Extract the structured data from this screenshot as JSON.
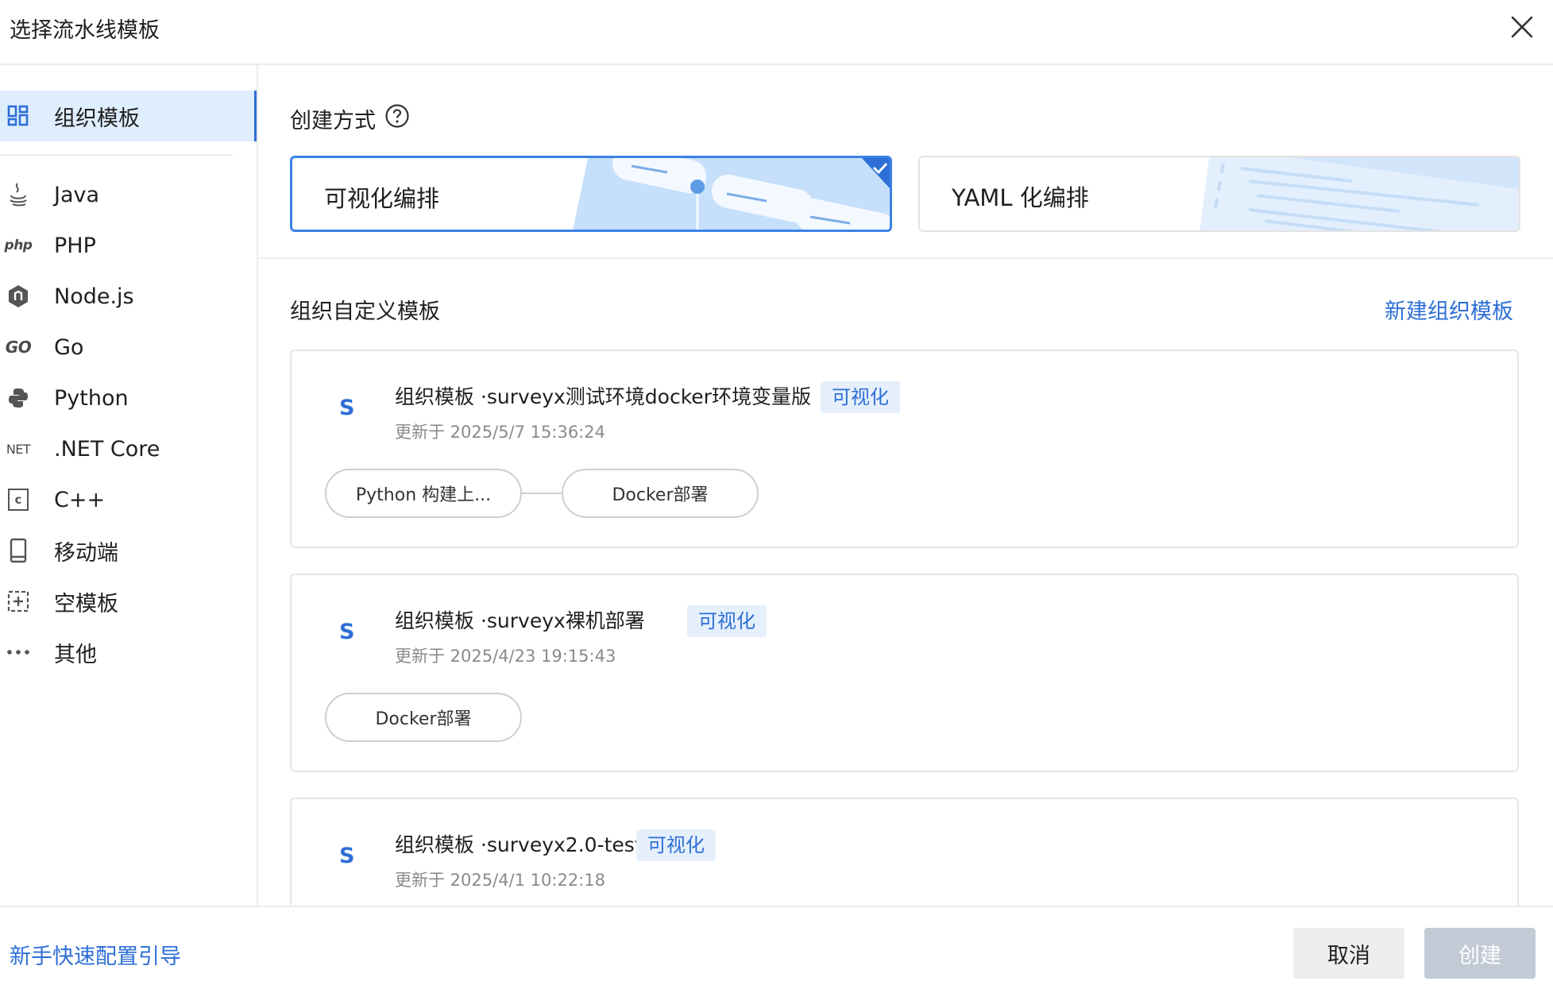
{
  "dialog": {
    "title": "选择流水线模板",
    "close_icon": "close-icon"
  },
  "sidebar": {
    "items": [
      {
        "label": "组织模板",
        "icon": "grid-icon",
        "active": true
      },
      {
        "label": "Java",
        "icon": "java-icon"
      },
      {
        "label": "PHP",
        "icon": "php-icon",
        "icon_text": "php"
      },
      {
        "label": "Node.js",
        "icon": "nodejs-icon"
      },
      {
        "label": "Go",
        "icon": "go-icon",
        "icon_text": "GO"
      },
      {
        "label": "Python",
        "icon": "python-icon"
      },
      {
        "label": ".NET Core",
        "icon": "dotnet-icon",
        "icon_text": "NET"
      },
      {
        "label": "C++",
        "icon": "cpp-icon",
        "icon_text": "c"
      },
      {
        "label": "移动端",
        "icon": "mobile-icon"
      },
      {
        "label": "空模板",
        "icon": "empty-template-icon"
      },
      {
        "label": "其他",
        "icon": "more-icon"
      }
    ]
  },
  "main": {
    "creation_label": "创建方式",
    "modes": [
      {
        "label": "可视化编排",
        "selected": true
      },
      {
        "label": "YAML 化编排",
        "selected": false
      }
    ],
    "custom_label": "组织自定义模板",
    "new_template_link": "新建组织模板",
    "templates": [
      {
        "logo": "S",
        "name": "组织模板 ·surveyx测试环境docker环境变量版",
        "tag": "可视化",
        "date": "更新于 2025/5/7 15:36:24",
        "stages": [
          "Python 构建上...",
          "Docker部署"
        ]
      },
      {
        "logo": "S",
        "name": "组织模板 ·surveyx裸机部署",
        "tag": "可视化",
        "date": "更新于 2025/4/23 19:15:43",
        "stages": [
          "Docker部署"
        ]
      },
      {
        "logo": "S",
        "name": "组织模板 ·surveyx2.0-test",
        "tag": "可视化",
        "date": "更新于 2025/4/1 10:22:18",
        "stages": []
      }
    ]
  },
  "footer": {
    "guide_link": "新手快速配置引导",
    "cancel": "取消",
    "create": "创建"
  },
  "colors": {
    "accent": "#2d6fd6",
    "active_bg": "#dfeefd",
    "tag_bg": "#e6f0fc",
    "disabled_btn": "#c2cad5"
  }
}
